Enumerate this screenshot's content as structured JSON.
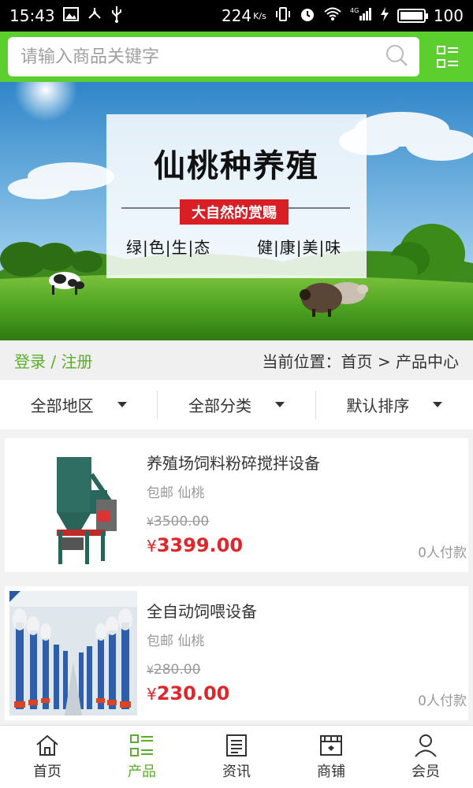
{
  "status_bar": {
    "time": "15:43",
    "net_speed": "224",
    "net_speed_unit": "K/s",
    "battery_level": "100",
    "network": "4G"
  },
  "search": {
    "placeholder": "请输入商品关键字"
  },
  "banner": {
    "title": "仙桃种养殖",
    "tagline": "大自然的赏赐",
    "left_words": "绿|色|生|态",
    "right_words": "健|康|美|味"
  },
  "location_bar": {
    "login": "登录 / 注册",
    "location": "当前位置：首页 > 产品中心"
  },
  "filters": [
    {
      "label": "全部地区"
    },
    {
      "label": "全部分类"
    },
    {
      "label": "默认排序"
    }
  ],
  "products": [
    {
      "title": "养殖场饲料粉碎搅拌设备",
      "tags": "包邮 仙桃",
      "currency": "¥",
      "old_price": "3500.00",
      "price": "3399.00",
      "paid": "0人付款"
    },
    {
      "title": "全自动饲喂设备",
      "tags": "包邮 仙桃",
      "currency": "¥",
      "old_price": "280.00",
      "price": "230.00",
      "paid": "0人付款"
    }
  ],
  "bottom_nav": [
    {
      "label": "首页",
      "icon": "home-icon"
    },
    {
      "label": "产品",
      "icon": "product-grid-icon",
      "active": true
    },
    {
      "label": "资讯",
      "icon": "news-icon"
    },
    {
      "label": "商铺",
      "icon": "store-icon"
    },
    {
      "label": "会员",
      "icon": "user-icon"
    }
  ],
  "colors": {
    "brand_green": "#5ccf2e",
    "price_red": "#e0262b"
  }
}
